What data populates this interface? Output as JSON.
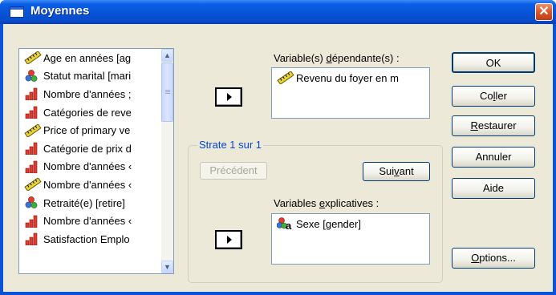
{
  "window": {
    "title": "Moyennes",
    "close_glyph": "✕"
  },
  "variables": [
    {
      "label": "Age en années [ag",
      "icon": "ruler-icon"
    },
    {
      "label": "Statut marital [mari",
      "icon": "nominal-icon"
    },
    {
      "label": "Nombre d'années ;",
      "icon": "ordinal-icon"
    },
    {
      "label": "Catégories de reve",
      "icon": "ordinal-icon"
    },
    {
      "label": "Price of primary ve",
      "icon": "ruler-icon"
    },
    {
      "label": "Catégorie de prix d",
      "icon": "ordinal-icon"
    },
    {
      "label": "Nombre d'années ‹",
      "icon": "ordinal-icon"
    },
    {
      "label": "Nombre d'années ‹",
      "icon": "ruler-icon"
    },
    {
      "label": "Retraité(e) [retire]",
      "icon": "nominal-icon"
    },
    {
      "label": "Nombre d'années ‹",
      "icon": "ordinal-icon"
    },
    {
      "label": "Satisfaction Emplo",
      "icon": "ordinal-icon"
    }
  ],
  "dependent": {
    "label_pre": "Variable(s) ",
    "label_ul": "d",
    "label_post": "épendante(s) :",
    "value": "Revenu du foyer en m"
  },
  "layer": {
    "title": "Strate 1 sur 1",
    "prev_label": "Précédent",
    "next_pre": "Sui",
    "next_ul": "v",
    "next_post": "ant"
  },
  "independent": {
    "label_pre": "Variables ",
    "label_ul": "e",
    "label_post": "xplicatives :",
    "value": "Sexe [gender]"
  },
  "buttons": {
    "ok": "OK",
    "paste_pre": "Co",
    "paste_ul": "l",
    "paste_post": "ler",
    "reset_ul": "R",
    "reset_post": "estaurer",
    "cancel": "Annuler",
    "help": "Aide",
    "options_ul": "O",
    "options_post": "ptions..."
  },
  "scrollbar": {
    "up": "▲",
    "down": "▼"
  }
}
